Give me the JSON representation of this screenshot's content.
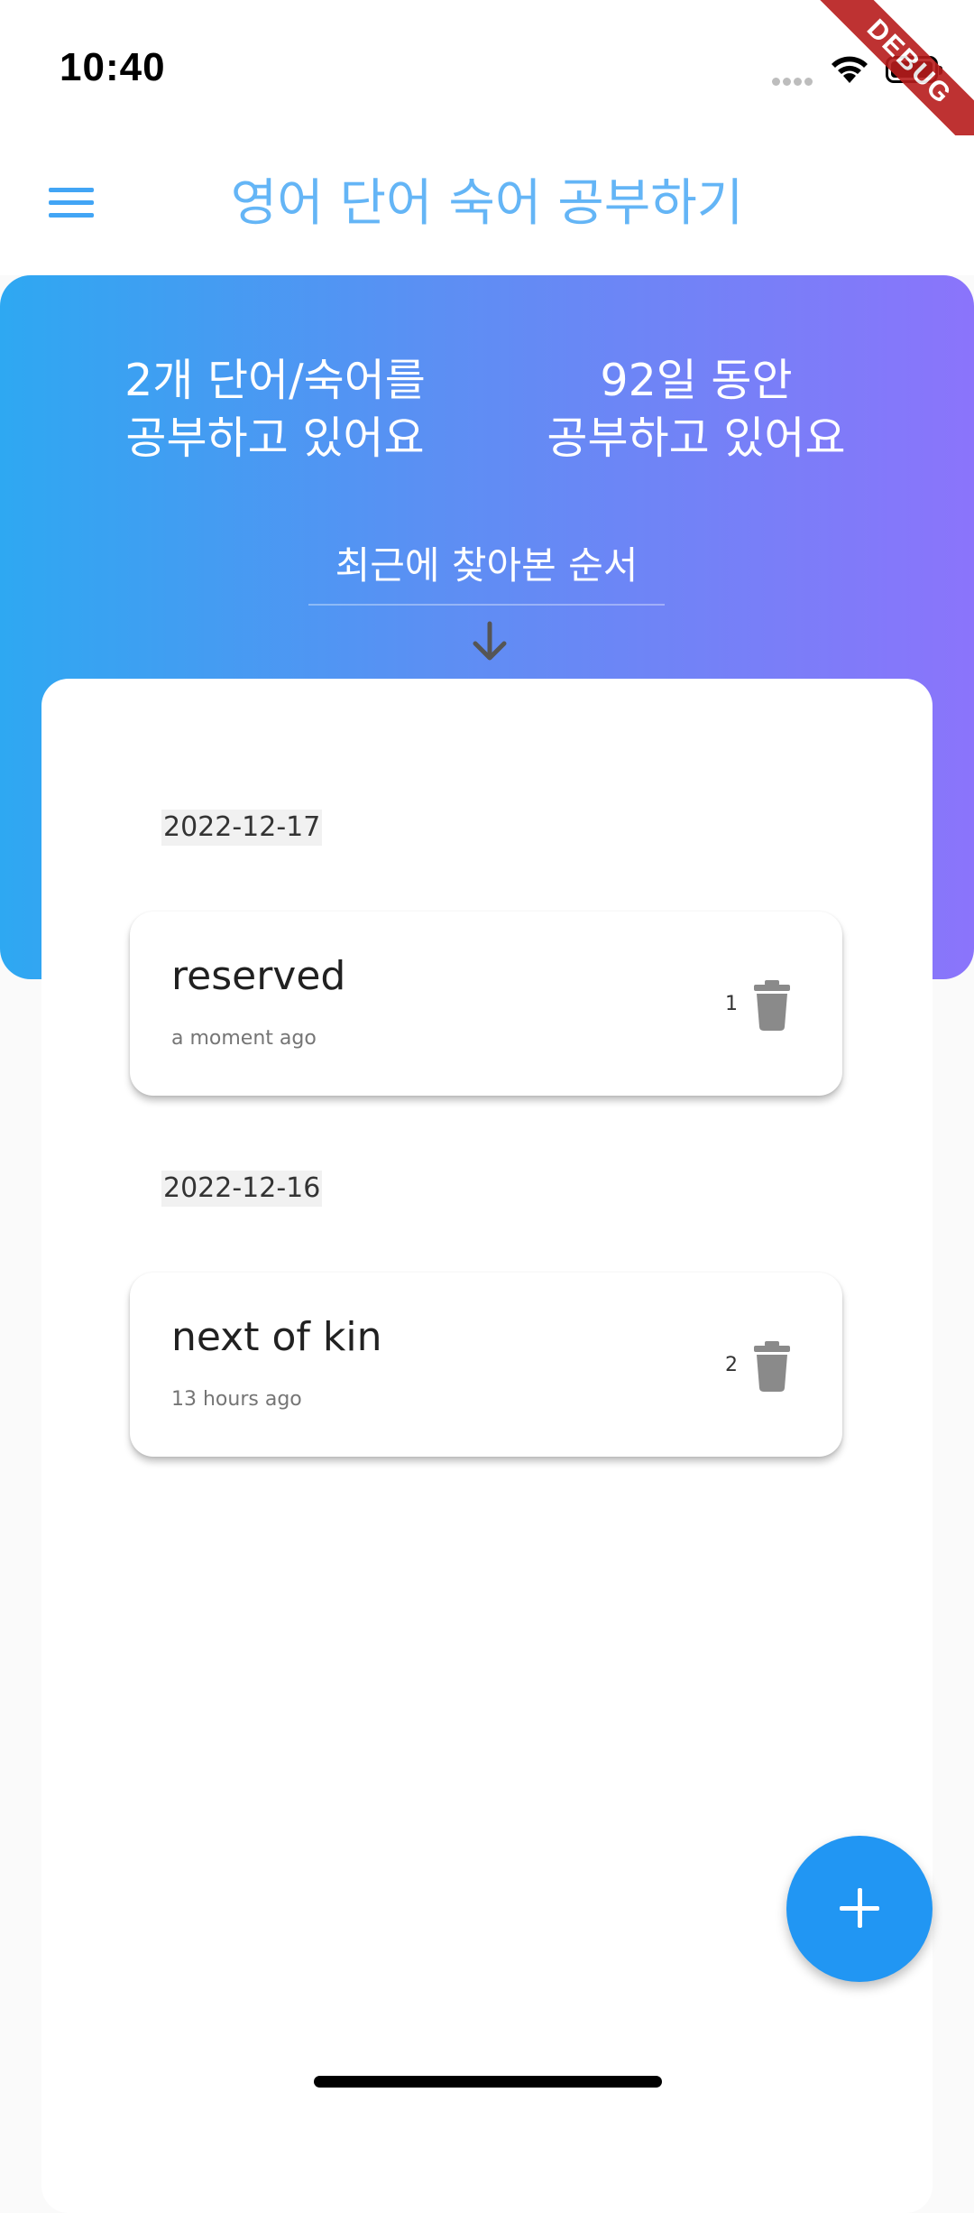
{
  "status_bar": {
    "time": "10:40"
  },
  "debug_banner": "DEBUG",
  "app_bar": {
    "title": "영어 단어 숙어 공부하기",
    "menu_icon": "hamburger-menu-icon"
  },
  "summary": {
    "word_count_line1": "2개 단어/숙어를",
    "word_count_line2": "공부하고 있어요",
    "days_line1": "92일 동안",
    "days_line2": "공부하고 있어요"
  },
  "sort": {
    "label": "최근에 찾아본 순서",
    "icon": "arrow-down-icon"
  },
  "groups": [
    {
      "date": "2022-12-17",
      "items": [
        {
          "word": "reserved",
          "time": "a moment ago",
          "count": "1",
          "icon": "trash-icon"
        }
      ]
    },
    {
      "date": "2022-12-16",
      "items": [
        {
          "word": "next of kin",
          "time": "13 hours ago",
          "count": "2",
          "icon": "trash-icon"
        }
      ]
    }
  ],
  "fab": {
    "icon": "plus-icon"
  },
  "colors": {
    "primary": "#2196f3",
    "title": "#64b5f6",
    "gradient_start": "#2ea8f2",
    "gradient_end": "#8b74fb"
  }
}
